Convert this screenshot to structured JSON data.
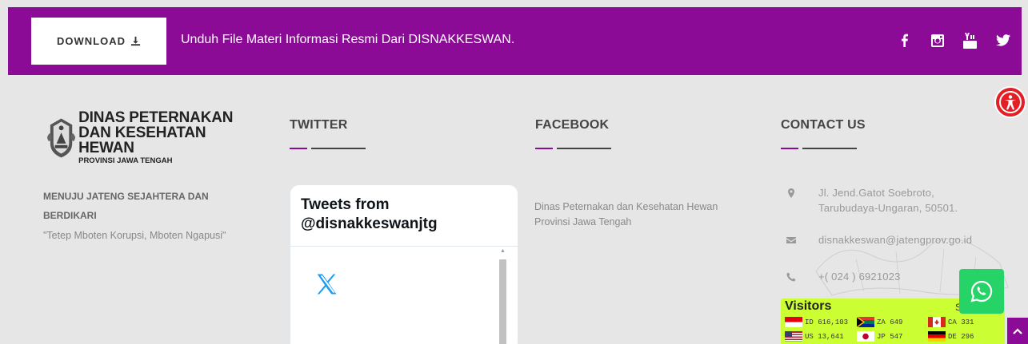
{
  "topbar": {
    "download_label": "DOWNLOAD",
    "message": "Unduh File Materi Informasi Resmi Dari DISNAKKESWAN.",
    "socials": [
      "facebook-icon",
      "instagram-icon",
      "youtube-icon",
      "twitter-icon"
    ],
    "bg_color": "#8b0a96"
  },
  "logo": {
    "line1": "DINAS PETERNAKAN",
    "line2": "DAN KESEHATAN HEWAN",
    "line3": "PROVINSI JAWA TENGAH"
  },
  "about": {
    "title": "MENUJU JATENG SEJAHTERA DAN BERDIKARI",
    "motto": "\"Tetep Mboten Korupsi, Mboten Ngapusi\""
  },
  "twitter": {
    "heading": "TWITTER",
    "widget_title": "Tweets from @disnakkeswanjtg"
  },
  "facebook": {
    "heading": "FACEBOOK",
    "text": "Dinas Peternakan dan Kesehatan Hewan Provinsi Jawa Tengah"
  },
  "contact": {
    "heading": "CONTACT US",
    "address": "Jl. Jend.Gatot Soebroto, Tarubudaya-Ungaran, 50501.",
    "email": "disnakkeswan@jatengprov.go.id",
    "phone": "+( 024 ) 6921023"
  },
  "visitors": {
    "title": "Visitors",
    "partial": "S",
    "entries": [
      {
        "code": "ID",
        "count": "616,103"
      },
      {
        "code": "ZA",
        "count": "649"
      },
      {
        "code": "CA",
        "count": "331"
      },
      {
        "code": "US",
        "count": "13,641"
      },
      {
        "code": "JP",
        "count": "547"
      },
      {
        "code": "DE",
        "count": "296"
      }
    ]
  },
  "accent_color": "#8b0a96"
}
